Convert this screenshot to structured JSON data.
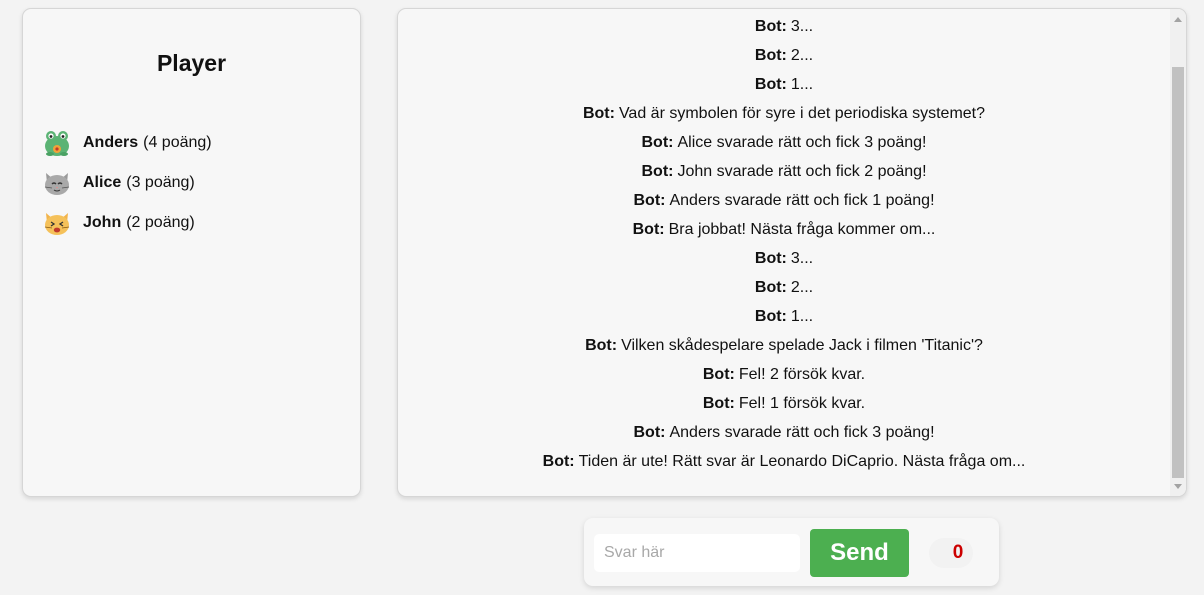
{
  "players": {
    "title": "Player",
    "list": [
      {
        "name": "Anders",
        "score": "(4 poäng)",
        "avatar": "frog-icon"
      },
      {
        "name": "Alice",
        "score": "(3 poäng)",
        "avatar": "cat-face-icon"
      },
      {
        "name": "John",
        "score": "(2 poäng)",
        "avatar": "cat-cheering-icon"
      }
    ]
  },
  "chat": {
    "messages": [
      {
        "sender": "Bot:",
        "text": "3..."
      },
      {
        "sender": "Bot:",
        "text": "2..."
      },
      {
        "sender": "Bot:",
        "text": "1..."
      },
      {
        "sender": "Bot:",
        "text": "Vad är symbolen för syre i det periodiska systemet?"
      },
      {
        "sender": "Bot:",
        "text": "Alice svarade rätt och fick 3 poäng!"
      },
      {
        "sender": "Bot:",
        "text": "John svarade rätt och fick 2 poäng!"
      },
      {
        "sender": "Bot:",
        "text": "Anders svarade rätt och fick 1 poäng!"
      },
      {
        "sender": "Bot:",
        "text": "Bra jobbat! Nästa fråga kommer om..."
      },
      {
        "sender": "Bot:",
        "text": "3..."
      },
      {
        "sender": "Bot:",
        "text": "2..."
      },
      {
        "sender": "Bot:",
        "text": "1..."
      },
      {
        "sender": "Bot:",
        "text": "Vilken skådespelare spelade Jack i filmen 'Titanic'?"
      },
      {
        "sender": "Bot:",
        "text": "Fel! 2 försök kvar."
      },
      {
        "sender": "Bot:",
        "text": "Fel! 1 försök kvar."
      },
      {
        "sender": "Bot:",
        "text": "Anders svarade rätt och fick 3 poäng!"
      },
      {
        "sender": "Bot:",
        "text": "Tiden är ute! Rätt svar är Leonardo DiCaprio. Nästa fråga om..."
      }
    ]
  },
  "input": {
    "placeholder": "Svar här",
    "value": "",
    "send_label": "Send",
    "timer": "0"
  },
  "colors": {
    "send_button": "#4caf50",
    "timer_text": "#cc0000",
    "panel_bg": "#f7f7f7",
    "page_bg": "#f3f3f3"
  }
}
